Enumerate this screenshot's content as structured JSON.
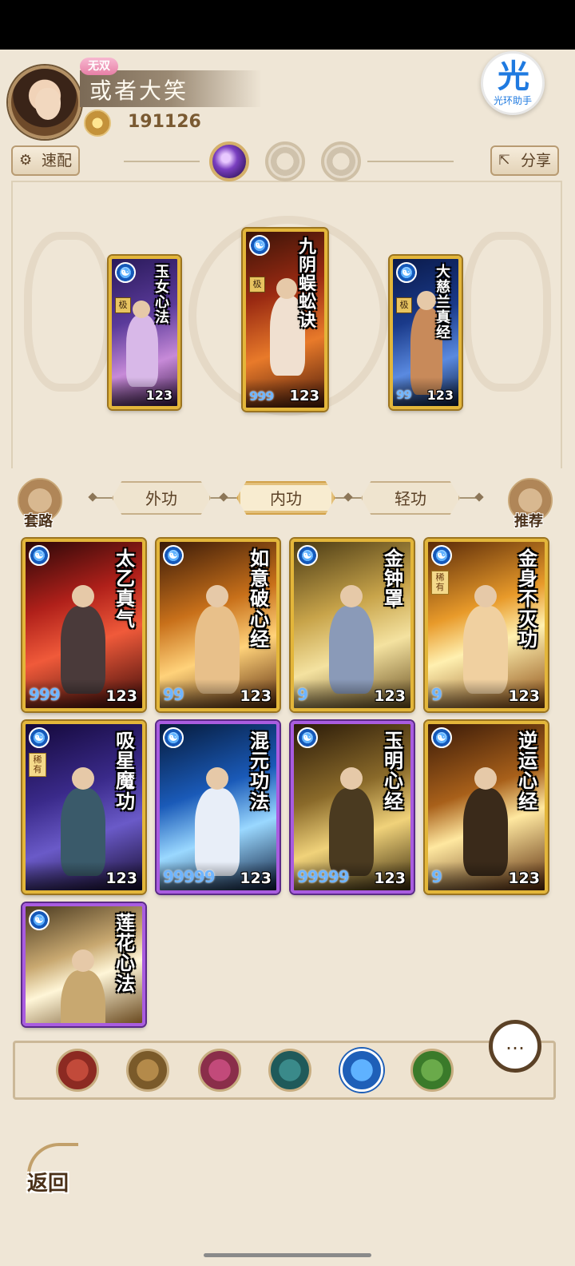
{
  "player": {
    "title_badge": "无双",
    "name": "或者大笑",
    "power": "191126"
  },
  "helper": {
    "glyph": "光",
    "label": "光环助手"
  },
  "toolbar": {
    "quick_config": "速配",
    "share": "分享"
  },
  "equipped": [
    {
      "name": "玉女心法",
      "grade": "极",
      "level": "123",
      "stars": ""
    },
    {
      "name": "九阴蜈蚣诀",
      "grade": "极",
      "level": "123",
      "stars": "999"
    },
    {
      "name": "大慈兰真经",
      "grade": "极",
      "level": "123",
      "stars": "99"
    }
  ],
  "side": {
    "left_label": "套路",
    "right_label": "推荐"
  },
  "tabs": [
    {
      "label": "外功",
      "active": false
    },
    {
      "label": "内功",
      "active": true
    },
    {
      "label": "轻功",
      "active": false
    }
  ],
  "skills": [
    {
      "name": "太乙真气",
      "level": "123",
      "stars": "999",
      "frame": "gold",
      "rarity": ""
    },
    {
      "name": "如意破心经",
      "level": "123",
      "stars": "99",
      "frame": "gold",
      "rarity": ""
    },
    {
      "name": "金钟罩",
      "level": "123",
      "stars": "9",
      "frame": "gold",
      "rarity": ""
    },
    {
      "name": "金身不灭功",
      "level": "123",
      "stars": "9",
      "frame": "gold",
      "rarity": "稀有"
    },
    {
      "name": "吸星魔功",
      "level": "123",
      "stars": "",
      "frame": "gold",
      "rarity": "稀有"
    },
    {
      "name": "混元功法",
      "level": "123",
      "stars": "99999",
      "frame": "purple",
      "rarity": ""
    },
    {
      "name": "玉明心经",
      "level": "123",
      "stars": "99999",
      "frame": "purple",
      "rarity": ""
    },
    {
      "name": "逆运心经",
      "level": "123",
      "stars": "9",
      "frame": "gold",
      "rarity": ""
    },
    {
      "name": "莲花心法",
      "level": "",
      "stars": "",
      "frame": "purple",
      "rarity": ""
    }
  ],
  "filters": [
    {
      "icon": "sword-school-icon",
      "color": "#8c2a22"
    },
    {
      "icon": "blade-school-icon",
      "color": "#7a5a2a"
    },
    {
      "icon": "fist-school-icon",
      "color": "#8a2e4a"
    },
    {
      "icon": "fan-school-icon",
      "color": "#1f5a5a"
    },
    {
      "icon": "yin-yang-school-icon",
      "color": "#1e5fb8"
    },
    {
      "icon": "palm-school-icon",
      "color": "#3a7a2a"
    }
  ],
  "chat": {
    "glyph": "…"
  },
  "back": {
    "label": "返回"
  }
}
